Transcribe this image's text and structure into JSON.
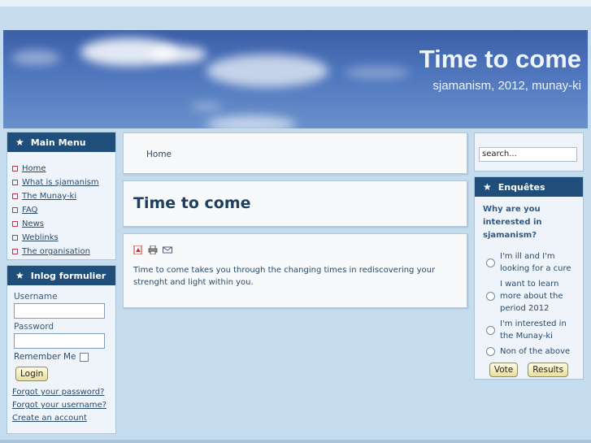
{
  "site": {
    "title": "Time to come",
    "subtitle": "sjamanism, 2012, munay-ki"
  },
  "main_menu": {
    "title": "Main Menu",
    "items": [
      "Home",
      "What is sjamanism",
      "The Munay-ki",
      "FAQ",
      "News",
      "Weblinks",
      "The organisation"
    ]
  },
  "login": {
    "title": "Inlog formulier",
    "username_label": "Username",
    "password_label": "Password",
    "remember_label": "Remember Me",
    "login_button": "Login",
    "links": [
      "Forgot your password?",
      "Forgot your username?",
      "Create an account"
    ]
  },
  "breadcrumb": "Home",
  "page": {
    "title": "Time to come",
    "body": "Time to come takes you through the changing times in rediscovering your strenght and light within you."
  },
  "search": {
    "value": "search..."
  },
  "poll": {
    "title": "Enquêtes",
    "question": "Why are you interested in sjamanism?",
    "options": [
      "I'm ill and I'm looking for a cure",
      "I want to learn more about the period 2012",
      "I'm interested in the Munay-ki",
      "Non of the above"
    ],
    "vote_button": "Vote",
    "results_button": "Results"
  },
  "colors": {
    "accent": "#1f4e7a",
    "background": "#c5dcef",
    "bullet": "#c0314e"
  }
}
